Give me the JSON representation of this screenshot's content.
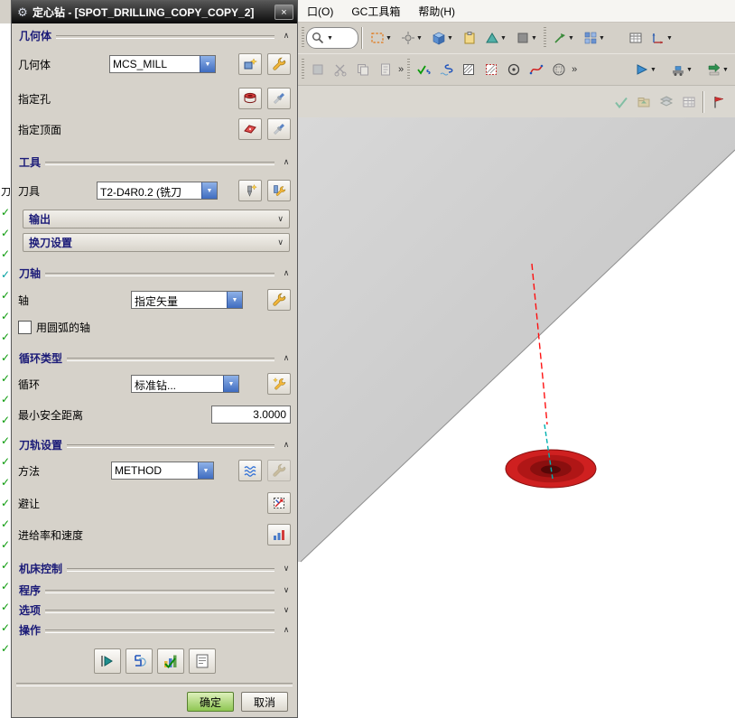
{
  "icons": {
    "gear": "⚙",
    "close": "×",
    "dropdown_arrow": "▼",
    "chevron_up": "∧",
    "chevron_down": "∨",
    "check": "✓",
    "overflow": "»"
  },
  "titlebar": {
    "title": "定心钻 - [SPOT_DRILLING_COPY_COPY_2]"
  },
  "menubar": {
    "items": [
      {
        "label": "口(O)"
      },
      {
        "label": "GC工具箱"
      },
      {
        "label": "帮助(H)"
      }
    ]
  },
  "navigator": {
    "partial_text": "刀",
    "checks_count": 22,
    "highlight_index": 3
  },
  "dialog": {
    "geometry": {
      "header": "几何体",
      "row_label": "几何体",
      "combo_value": "MCS_MILL",
      "specify_holes": "指定孔",
      "specify_top_face": "指定顶面"
    },
    "tool": {
      "header": "工具",
      "row_label": "刀具",
      "combo_value": "T2-D4R0.2 (铣刀",
      "output": "输出",
      "tool_change": "换刀设置"
    },
    "axis": {
      "header": "刀轴",
      "row_label": "轴",
      "combo_value": "指定矢量",
      "arc_axis": "用圆弧的轴"
    },
    "cycle": {
      "header": "循环类型",
      "row_label": "循环",
      "combo_value": "标准钻...",
      "min_clearance_label": "最小安全距离",
      "min_clearance_value": "3.0000"
    },
    "path": {
      "header": "刀轨设置",
      "method_label": "方法",
      "method_value": "METHOD",
      "avoid_label": "避让",
      "feeds_label": "进给率和速度"
    },
    "bars": {
      "machine": "机床控制",
      "program": "程序",
      "options": "选项",
      "actions": "操作"
    },
    "footer": {
      "ok": "确定",
      "cancel": "取消"
    }
  }
}
